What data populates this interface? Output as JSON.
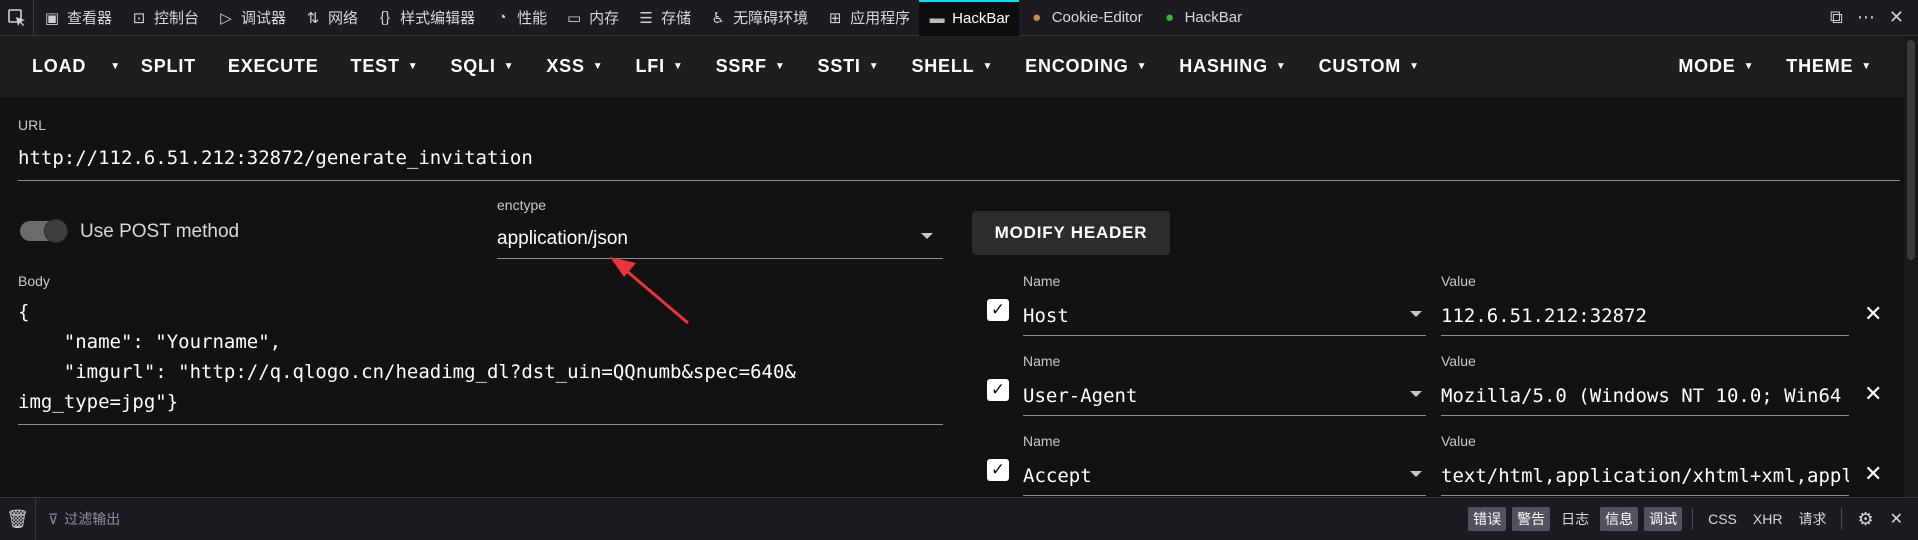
{
  "devtools": {
    "tabs": [
      {
        "icon": "inspector-icon",
        "label": "查看器"
      },
      {
        "icon": "console-icon",
        "label": "控制台"
      },
      {
        "icon": "debugger-icon",
        "label": "调试器"
      },
      {
        "icon": "network-icon",
        "label": "网络"
      },
      {
        "icon": "style-editor-icon",
        "label": "样式编辑器"
      },
      {
        "icon": "performance-icon",
        "label": "性能"
      },
      {
        "icon": "memory-icon",
        "label": "内存"
      },
      {
        "icon": "storage-icon",
        "label": "存储"
      },
      {
        "icon": "accessibility-icon",
        "label": "无障碍环境"
      },
      {
        "icon": "application-icon",
        "label": "应用程序"
      },
      {
        "icon": "hackbar-icon",
        "label": "HackBar"
      },
      {
        "icon": "cookie-icon",
        "label": "Cookie-Editor"
      },
      {
        "icon": "hackbar-leaf-icon",
        "label": "HackBar"
      }
    ],
    "active_tab": "HackBar"
  },
  "hackbar": {
    "toolbar": {
      "load": "LOAD",
      "split": "SPLIT",
      "execute": "EXECUTE",
      "test": "TEST",
      "sqli": "SQLI",
      "xss": "XSS",
      "lfi": "LFI",
      "ssrf": "SSRF",
      "ssti": "SSTI",
      "shell": "SHELL",
      "encoding": "ENCODING",
      "hashing": "HASHING",
      "custom": "CUSTOM",
      "mode": "MODE",
      "theme": "THEME"
    },
    "url_label": "URL",
    "url": "http://112.6.51.212:32872/generate_invitation",
    "post_toggle_label": "Use POST method",
    "enctype_label": "enctype",
    "enctype": "application/json",
    "modify_header": "MODIFY HEADER",
    "body_label": "Body",
    "body": "{\n    \"name\": \"Yourname\",\n    \"imgurl\": \"http://q.qlogo.cn/headimg_dl?dst_uin=QQnumb&spec=640&\nimg_type=jpg\"}",
    "name_label": "Name",
    "value_label": "Value",
    "headers": [
      {
        "name": "Host",
        "value": "112.6.51.212:32872"
      },
      {
        "name": "User-Agent",
        "value": "Mozilla/5.0 (Windows NT 10.0; Win64"
      },
      {
        "name": "Accept",
        "value": "text/html,application/xhtml+xml,appl"
      }
    ]
  },
  "console": {
    "filter_placeholder": "过滤输出",
    "levels": [
      "错误",
      "警告",
      "日志",
      "信息",
      "调试"
    ],
    "levels_active": [
      true,
      true,
      false,
      true,
      true
    ],
    "extras": [
      "CSS",
      "XHR",
      "请求"
    ]
  }
}
